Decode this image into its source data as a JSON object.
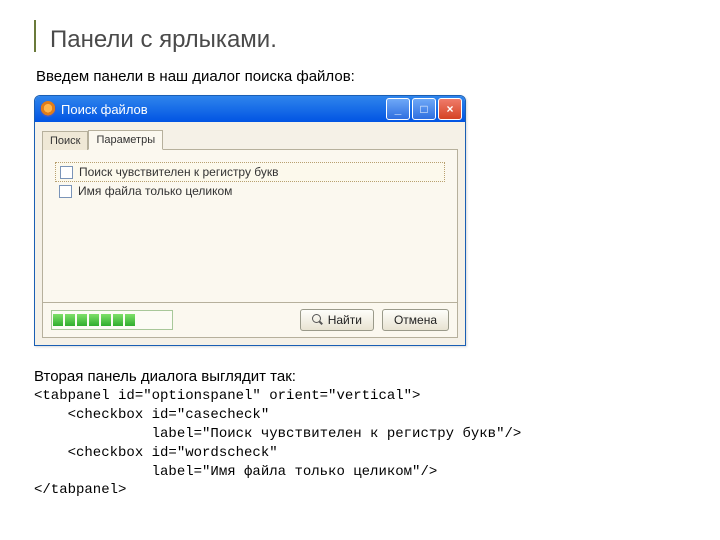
{
  "page": {
    "title": "Панели с ярлыками.",
    "intro": "Введем панели в наш диалог поиска файлов:",
    "subhead": "Вторая панель диалога выглядит так:"
  },
  "window": {
    "title": "Поиск файлов",
    "tabs": {
      "search": "Поиск",
      "params": "Параметры"
    },
    "options": {
      "casecheck": "Поиск чувствителен к регистру букв",
      "wordscheck": "Имя файла только целиком"
    },
    "buttons": {
      "find": "Найти",
      "cancel": "Отмена"
    }
  },
  "code": "<tabpanel id=\"optionspanel\" orient=\"vertical\">\n    <checkbox id=\"casecheck\"\n              label=\"Поиск чувствителен к регистру букв\"/>\n    <checkbox id=\"wordscheck\"\n              label=\"Имя файла только целиком\"/>\n</tabpanel>"
}
